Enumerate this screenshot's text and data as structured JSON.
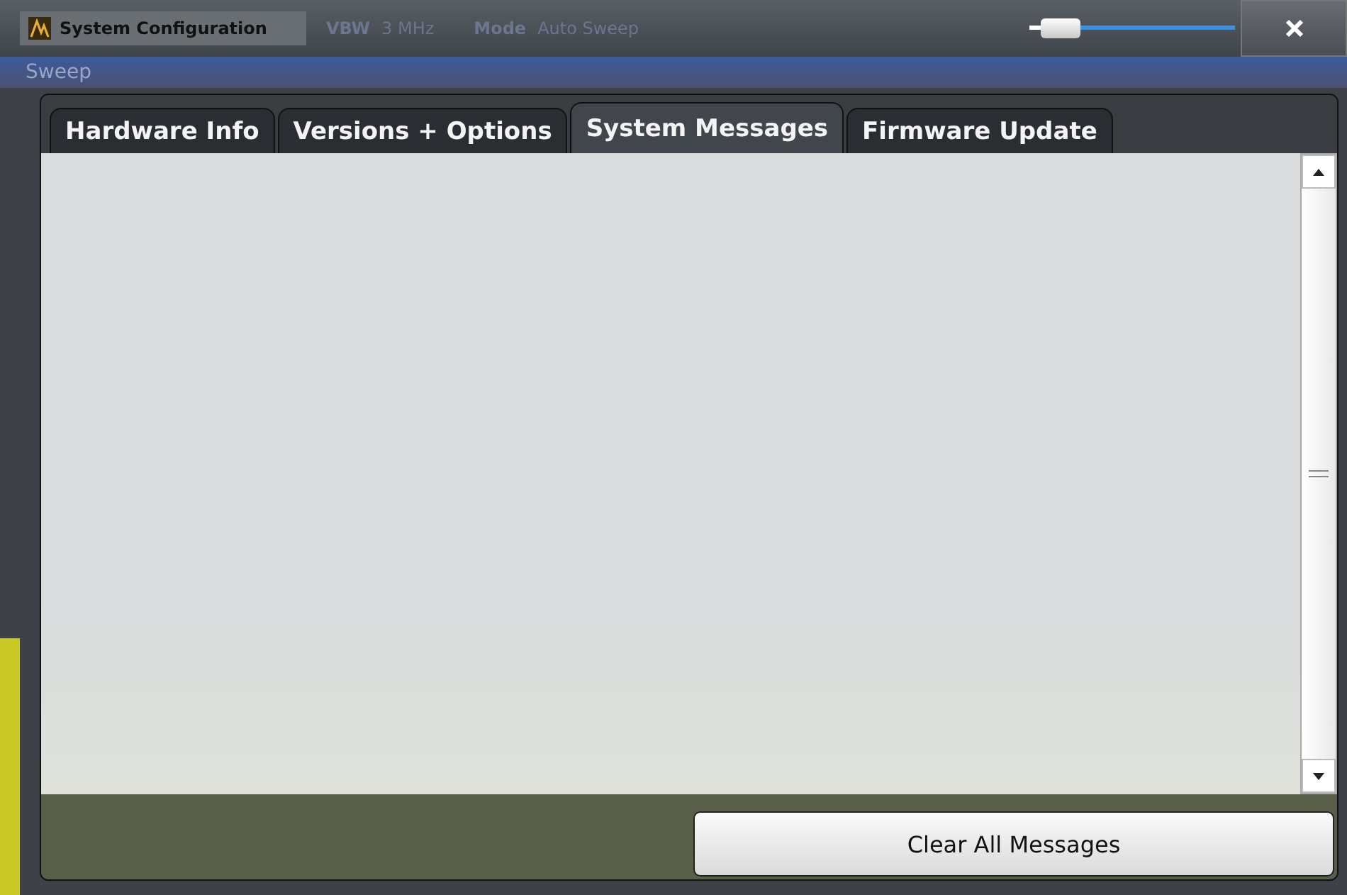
{
  "window": {
    "title": "System Configuration"
  },
  "background_labels": [
    {
      "label": "VBW",
      "value": "3 MHz"
    },
    {
      "label": "Mode",
      "value": "Auto Sweep"
    }
  ],
  "background_heading": "Sweep",
  "title_slider": {
    "level": 0.15
  },
  "tabs": [
    {
      "label": "Hardware Info",
      "selected": false
    },
    {
      "label": "Versions + Options",
      "selected": false
    },
    {
      "label": "System Messages",
      "selected": true
    },
    {
      "label": "Firmware Update",
      "selected": false
    }
  ],
  "buttons": [
    "Clear All Messages"
  ]
}
